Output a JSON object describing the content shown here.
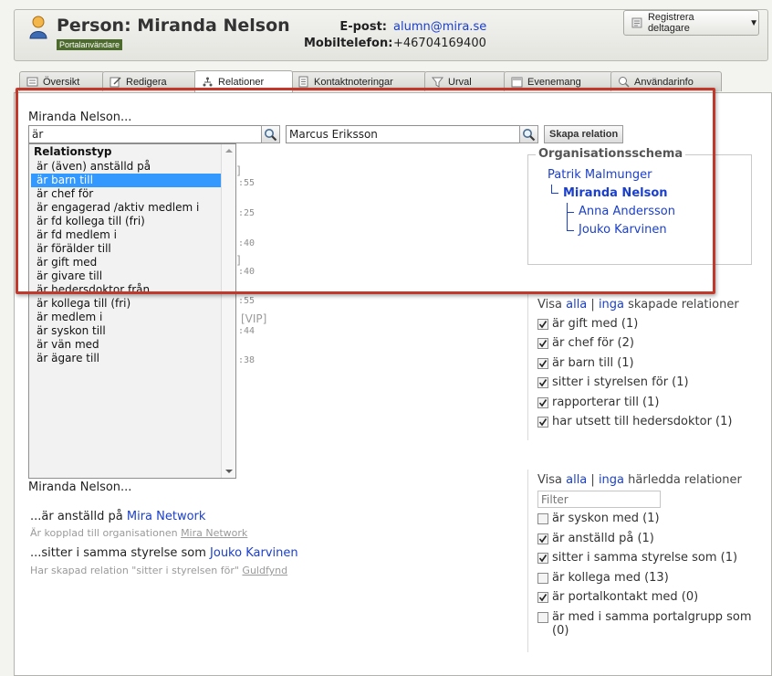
{
  "header": {
    "title": "Person: Miranda Nelson",
    "badge": "Portalanvändare",
    "email_label": "E-post:",
    "email": "alumn@mira.se",
    "mobile_label": "Mobiltelefon:",
    "mobile": "+46704169400",
    "register_button": "Registrera deltagare"
  },
  "tabs": [
    {
      "label": "Översikt",
      "icon": "overview-icon"
    },
    {
      "label": "Redigera",
      "icon": "edit-icon"
    },
    {
      "label": "Relationer",
      "icon": "relations-icon"
    },
    {
      "label": "Kontaktnoteringar",
      "icon": "notes-icon"
    },
    {
      "label": "Urval",
      "icon": "filter-icon"
    },
    {
      "label": "Evenemang",
      "icon": "calendar-icon"
    },
    {
      "label": "Användarinfo",
      "icon": "user-info-icon"
    }
  ],
  "active_tab": "Relationer",
  "relation_form": {
    "subject": "Miranda Nelson...",
    "relation_input": "är",
    "target_input": "Marcus Eriksson",
    "create_button": "Skapa relation"
  },
  "dropdown": {
    "header": "Relationstyp",
    "selected_index": 1,
    "items": [
      "är (även) anställd på",
      "är barn till",
      "är chef för",
      "är engagerad /aktiv medlem i",
      "är fd kollega till (fri)",
      "är fd medlem i",
      "är förälder till",
      "är gift med",
      "är givare till",
      "är hedersdoktor från",
      "är kollega till (fri)",
      "är medlem i",
      "är syskon till",
      "är vän med",
      "är ägare till"
    ]
  },
  "background_fragments": {
    "b1": "]",
    "t1": ":55",
    "t2": ":25",
    "t3": ":40",
    "b2": "]",
    "t4": ":40",
    "t5": ":55",
    "vip": "[VIP]",
    "t6": ":44",
    "t7": ":38"
  },
  "org_schema": {
    "title": "Organisationsschema",
    "root": "Patrik Malmunger",
    "current": "Miranda Nelson",
    "children": [
      "Anna Andersson",
      "Jouko Karvinen"
    ]
  },
  "created_filter": {
    "prefix": "Visa",
    "all": "alla",
    "sep": "|",
    "none": "inga",
    "suffix": "skapade relationer",
    "items": [
      {
        "label": "är gift med (1)",
        "checked": true
      },
      {
        "label": "är chef för (2)",
        "checked": true
      },
      {
        "label": "är barn till (1)",
        "checked": true
      },
      {
        "label": "sitter i styrelsen för (1)",
        "checked": true
      },
      {
        "label": "rapporterar till (1)",
        "checked": true
      },
      {
        "label": "har utsett till hedersdoktor (1)",
        "checked": true
      }
    ]
  },
  "derived_filter": {
    "prefix": "Visa",
    "all": "alla",
    "sep": "|",
    "none": "inga",
    "suffix": "härledda relationer",
    "filter_placeholder": "Filter",
    "items": [
      {
        "label": "är syskon med (1)",
        "checked": false
      },
      {
        "label": "är anställd på (1)",
        "checked": true
      },
      {
        "label": "sitter i samma styrelse som (1)",
        "checked": true
      },
      {
        "label": "är kollega med (13)",
        "checked": false
      },
      {
        "label": "är portalkontakt med (0)",
        "checked": true
      },
      {
        "label": "är med i samma portalgrupp som (0)",
        "checked": false
      }
    ]
  },
  "derived_relations": {
    "subject": "Miranda Nelson...",
    "items": [
      {
        "prefix": "...är anställd på",
        "target": "Mira Network",
        "note_prefix": "Är kopplad till organisationen",
        "note_link": "Mira Network"
      },
      {
        "prefix": "...sitter i samma styrelse som",
        "target": "Jouko Karvinen",
        "note_prefix": "Har skapad relation \"sitter i styrelsen för\"",
        "note_link": "Guldfynd"
      }
    ]
  },
  "colors": {
    "link": "#1a3fcc",
    "highlight": "#c0392b",
    "selected": "#3399ff",
    "badge": "#4d6b2d"
  }
}
